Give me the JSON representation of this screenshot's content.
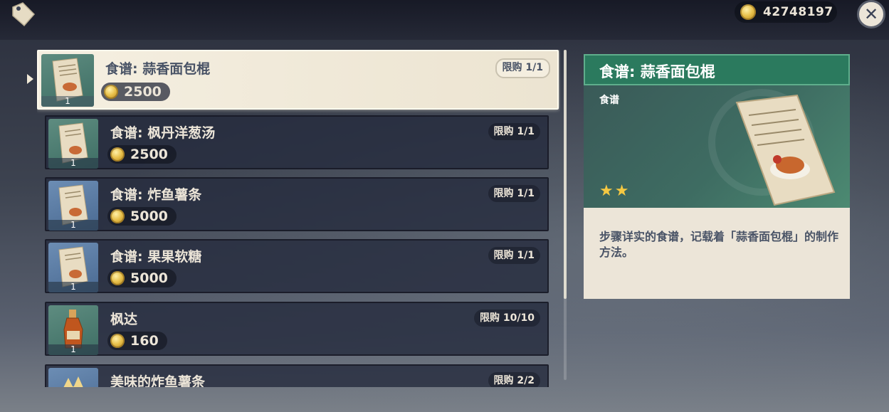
{
  "header": {
    "tag_icon": "tag-icon",
    "currency_value": "42748197",
    "close_icon": "close-icon",
    "close_glyph": "✕"
  },
  "shop_items": [
    {
      "name": "食谱: 蒜香面包棍",
      "price": "2500",
      "limit": "限购 1/1",
      "qty": "1",
      "icon": "recipe-icon",
      "selected": true
    },
    {
      "name": "食谱: 枫丹洋葱汤",
      "price": "2500",
      "limit": "限购 1/1",
      "qty": "1",
      "icon": "recipe-icon"
    },
    {
      "name": "食谱: 炸鱼薯条",
      "price": "5000",
      "limit": "限购 1/1",
      "qty": "1",
      "icon": "recipe-icon"
    },
    {
      "name": "食谱: 果果软糖",
      "price": "5000",
      "limit": "限购 1/1",
      "qty": "1",
      "icon": "recipe-icon"
    },
    {
      "name": "枫达",
      "price": "160",
      "limit": "限购 10/10",
      "qty": "1",
      "icon": "bottle-icon"
    },
    {
      "name": "美味的炸鱼薯条",
      "price": "",
      "limit": "限购 2/2",
      "qty": "",
      "icon": "dish-icon"
    }
  ],
  "detail": {
    "title": "食谱: 蒜香面包棍",
    "type": "食谱",
    "stars": "★★",
    "description": "步骤详实的食谱，记载着「蒜香面包棍」的制作方法。"
  },
  "colors": {
    "header_green": "#2b7a5e",
    "parchment": "#ece5d8",
    "coin_gold": "#e8c04a",
    "star_gold": "#f5c842"
  }
}
